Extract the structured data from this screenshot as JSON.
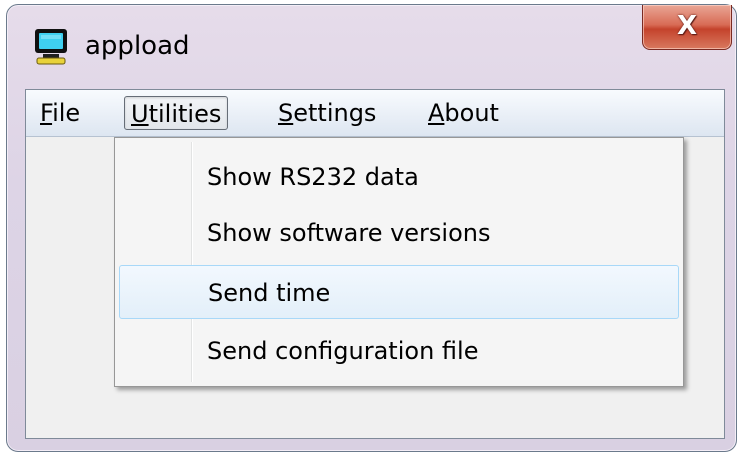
{
  "window": {
    "title": "appload",
    "close_glyph": "X"
  },
  "icons": {
    "app": "computer-monitor-icon"
  },
  "menubar": {
    "items": [
      {
        "label": "File",
        "mnemonic": "F"
      },
      {
        "label": "Utilities",
        "mnemonic": "U"
      },
      {
        "label": "Settings",
        "mnemonic": "S"
      },
      {
        "label": "About",
        "mnemonic": "A"
      }
    ],
    "open_menu": "Utilities"
  },
  "utilities_menu": {
    "items": [
      {
        "label": "Show RS232 data"
      },
      {
        "label": "Show software versions"
      },
      {
        "label": "Send time",
        "highlighted": true
      },
      {
        "label": "Send configuration file"
      }
    ]
  },
  "colors": {
    "close_button": "#d05a45",
    "highlight": "#e3eff9"
  }
}
